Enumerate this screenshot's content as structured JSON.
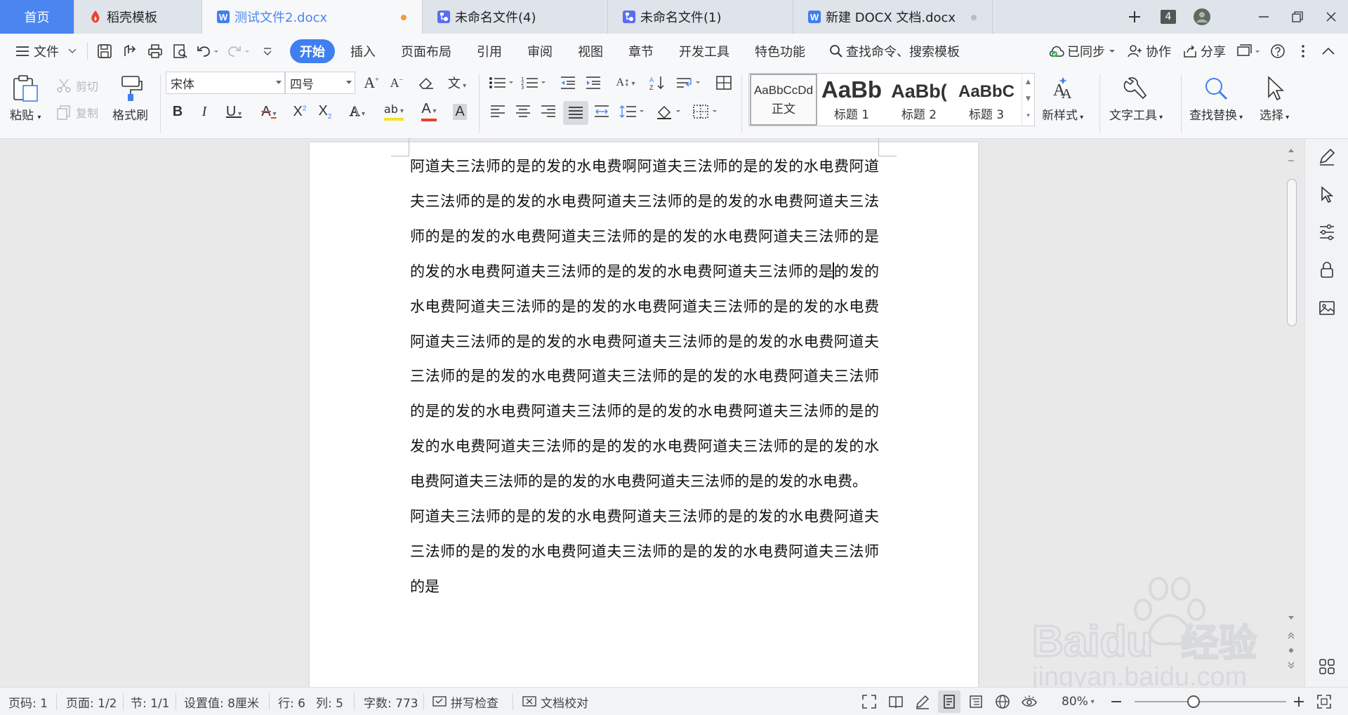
{
  "tabs": {
    "home": "首页",
    "template": "稻壳模板",
    "doc1": "测试文件2.docx",
    "doc2": "未命名文件(4)",
    "doc3": "未命名文件(1)",
    "doc4": "新建 DOCX 文档.docx",
    "count": "4"
  },
  "menu": {
    "file": "文件",
    "items": [
      "开始",
      "插入",
      "页面布局",
      "引用",
      "审阅",
      "视图",
      "章节",
      "开发工具",
      "特色功能"
    ],
    "search": "查找命令、搜索模板",
    "sync": "已同步",
    "collab": "协作",
    "share": "分享"
  },
  "ribbon": {
    "paste": "粘贴",
    "cut": "剪切",
    "copy": "复制",
    "format_painter": "格式刷",
    "font_name": "宋体",
    "font_size": "四号",
    "styles": [
      {
        "preview": "AaBbCcDd",
        "name": "正文"
      },
      {
        "preview": "AaBb",
        "name": "标题 1"
      },
      {
        "preview": "AaBb(",
        "name": "标题 2"
      },
      {
        "preview": "AaBbC",
        "name": "标题 3"
      }
    ],
    "new_style": "新样式",
    "text_tools": "文字工具",
    "find_replace": "查找替换",
    "select": "选择"
  },
  "document": {
    "para1_before_caret": "阿道夫三法师的是的发的水电费啊阿道夫三法师的是的发的水电费阿道夫三法师的是的发的水电费阿道夫三法师的是的发的水电费阿道夫三法师的是的发的水电费阿道夫三法师的是的发的水电费阿道夫三法师的是的发的水电费阿道夫三法师的是的发的水电费阿道夫三法师的是",
    "para1_after_caret": "的发的水电费阿道夫三法师的是的发的水电费阿道夫三法师的是的发的水电费阿道夫三法师的是的发的水电费阿道夫三法师的是的发的水电费阿道夫三法师的是的发的水电费阿道夫三法师的是的发的水电费阿道夫三法师的是的发的水电费阿道夫三法师的是的发的水电费阿道夫三法师的是的发的水电费阿道夫三法师的是的发的水电费阿道夫三法师的是的发的水电费阿道夫三法师的是的发的水电费阿道夫三法师的是的发的水电费。",
    "para2": "阿道夫三法师的是的发的水电费阿道夫三法师的是的发的水电费阿道夫三法师的是的发的水电费阿道夫三法师的是的发的水电费阿道夫三法师的是"
  },
  "status": {
    "page_num": "页码: 1",
    "pages": "页面: 1/2",
    "section": "节: 1/1",
    "setting": "设置值: 8厘米",
    "row": "行: 6",
    "col": "列: 5",
    "words": "字数: 773",
    "spell": "拼写检查",
    "proof": "文档校对",
    "zoom": "80%",
    "zoom_level": 0.8
  },
  "watermark": {
    "brand": "Baidu",
    "cn": "经验",
    "url": "jingyan.baidu.com"
  },
  "colors": {
    "accent": "#3f7ff0",
    "home_tab": "#4b86f0",
    "wps_red": "#e8432e",
    "modified_dot": "#f59a3b"
  }
}
